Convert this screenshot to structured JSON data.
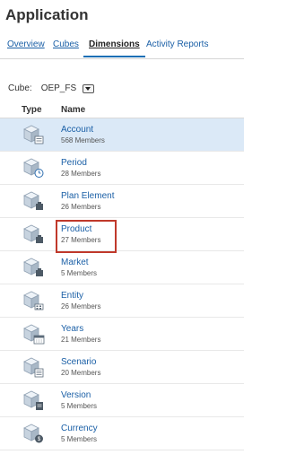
{
  "app": {
    "title": "Application"
  },
  "tabs": [
    {
      "label": "Overview",
      "active": false
    },
    {
      "label": "Cubes",
      "active": false
    },
    {
      "label": "Dimensions",
      "active": true
    },
    {
      "label": "Activity Reports",
      "active": false
    }
  ],
  "cube": {
    "label": "Cube:",
    "value": "OEP_FS"
  },
  "table": {
    "headers": {
      "type": "Type",
      "name": "Name"
    },
    "rows": [
      {
        "name": "Account",
        "members": "568 Members",
        "icon": "account-dimension-icon",
        "selected": true
      },
      {
        "name": "Period",
        "members": "28 Members",
        "icon": "period-dimension-icon"
      },
      {
        "name": "Plan Element",
        "members": "26 Members",
        "icon": "plan-element-dimension-icon"
      },
      {
        "name": "Product",
        "members": "27 Members",
        "icon": "product-dimension-icon",
        "highlighted": true
      },
      {
        "name": "Market",
        "members": "5 Members",
        "icon": "market-dimension-icon"
      },
      {
        "name": "Entity",
        "members": "26 Members",
        "icon": "entity-dimension-icon"
      },
      {
        "name": "Years",
        "members": "21 Members",
        "icon": "years-dimension-icon"
      },
      {
        "name": "Scenario",
        "members": "20 Members",
        "icon": "scenario-dimension-icon"
      },
      {
        "name": "Version",
        "members": "5 Members",
        "icon": "version-dimension-icon"
      },
      {
        "name": "Currency",
        "members": "5 Members",
        "icon": "currency-dimension-icon"
      }
    ]
  },
  "colors": {
    "link": "#1a5fa6",
    "selected_row": "#dbe9f7",
    "highlight_border": "#c0392b",
    "tab_underline": "#1a6fb5"
  }
}
